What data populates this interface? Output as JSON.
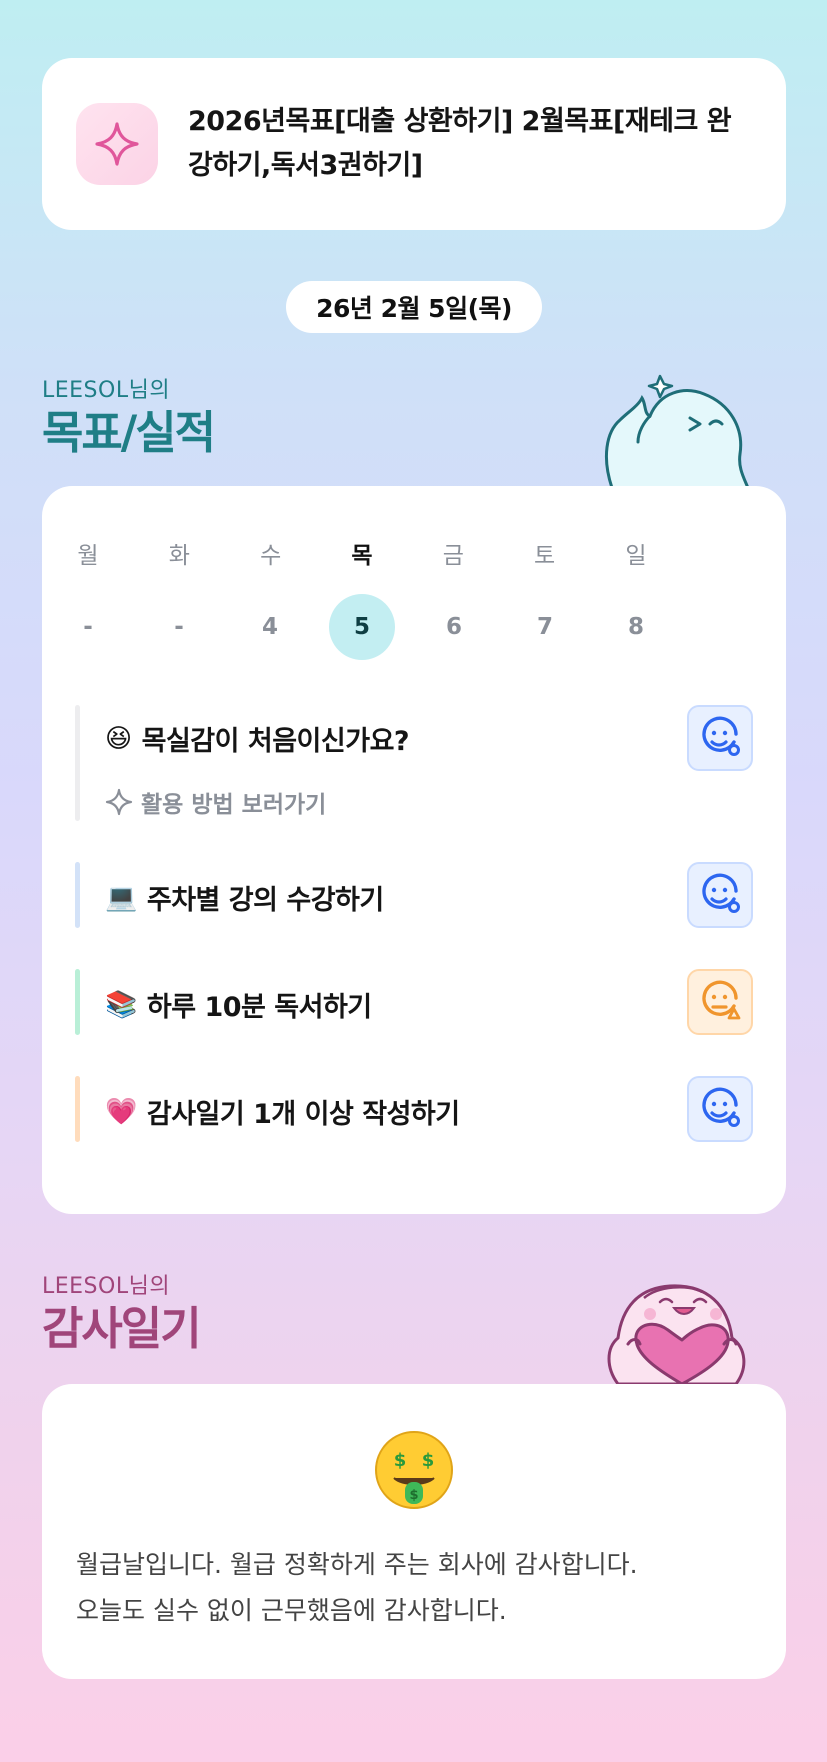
{
  "goal_banner": {
    "icon": "sparkle-icon",
    "text": "2026년목표[대출 상환하기] 2월목표[재테크 완강하기,독서3권하기]"
  },
  "date_label": "26년 2월 5일(목)",
  "goals_section": {
    "subtitle": "LEESOL님의",
    "title": "목표/실적"
  },
  "calendar": {
    "weekdays": [
      "월",
      "화",
      "수",
      "목",
      "금",
      "토",
      "일"
    ],
    "dates": [
      "-",
      "-",
      "4",
      "5",
      "6",
      "7",
      "8"
    ],
    "selected_index": 3
  },
  "tasks": [
    {
      "emoji": "😆",
      "label": "목실감이 처음이신가요?",
      "sub_label": "활용 방법 보러가기",
      "mood": "blue"
    },
    {
      "emoji": "💻",
      "label": "주차별 강의 수강하기",
      "mood": "blue"
    },
    {
      "emoji": "📚",
      "label": "하루 10분 독서하기",
      "mood": "orange"
    },
    {
      "emoji": "💗",
      "label": "감사일기 1개 이상 작성하기",
      "mood": "blue"
    }
  ],
  "diary_section": {
    "subtitle": "LEESOL님의",
    "title": "감사일기"
  },
  "diary": {
    "emoji": "🤑",
    "lines": [
      "월급날입니다. 월급 정확하게 주는 회사에 감사합니다.",
      "오늘도 실수 없이 근무했음에 감사합니다."
    ]
  },
  "colors": {
    "accent_teal": "#1f7e86",
    "accent_pink": "#a0457a",
    "selected_date": "#c3eef2",
    "mood_blue": "#2d66f0",
    "mood_orange": "#f0952d"
  }
}
